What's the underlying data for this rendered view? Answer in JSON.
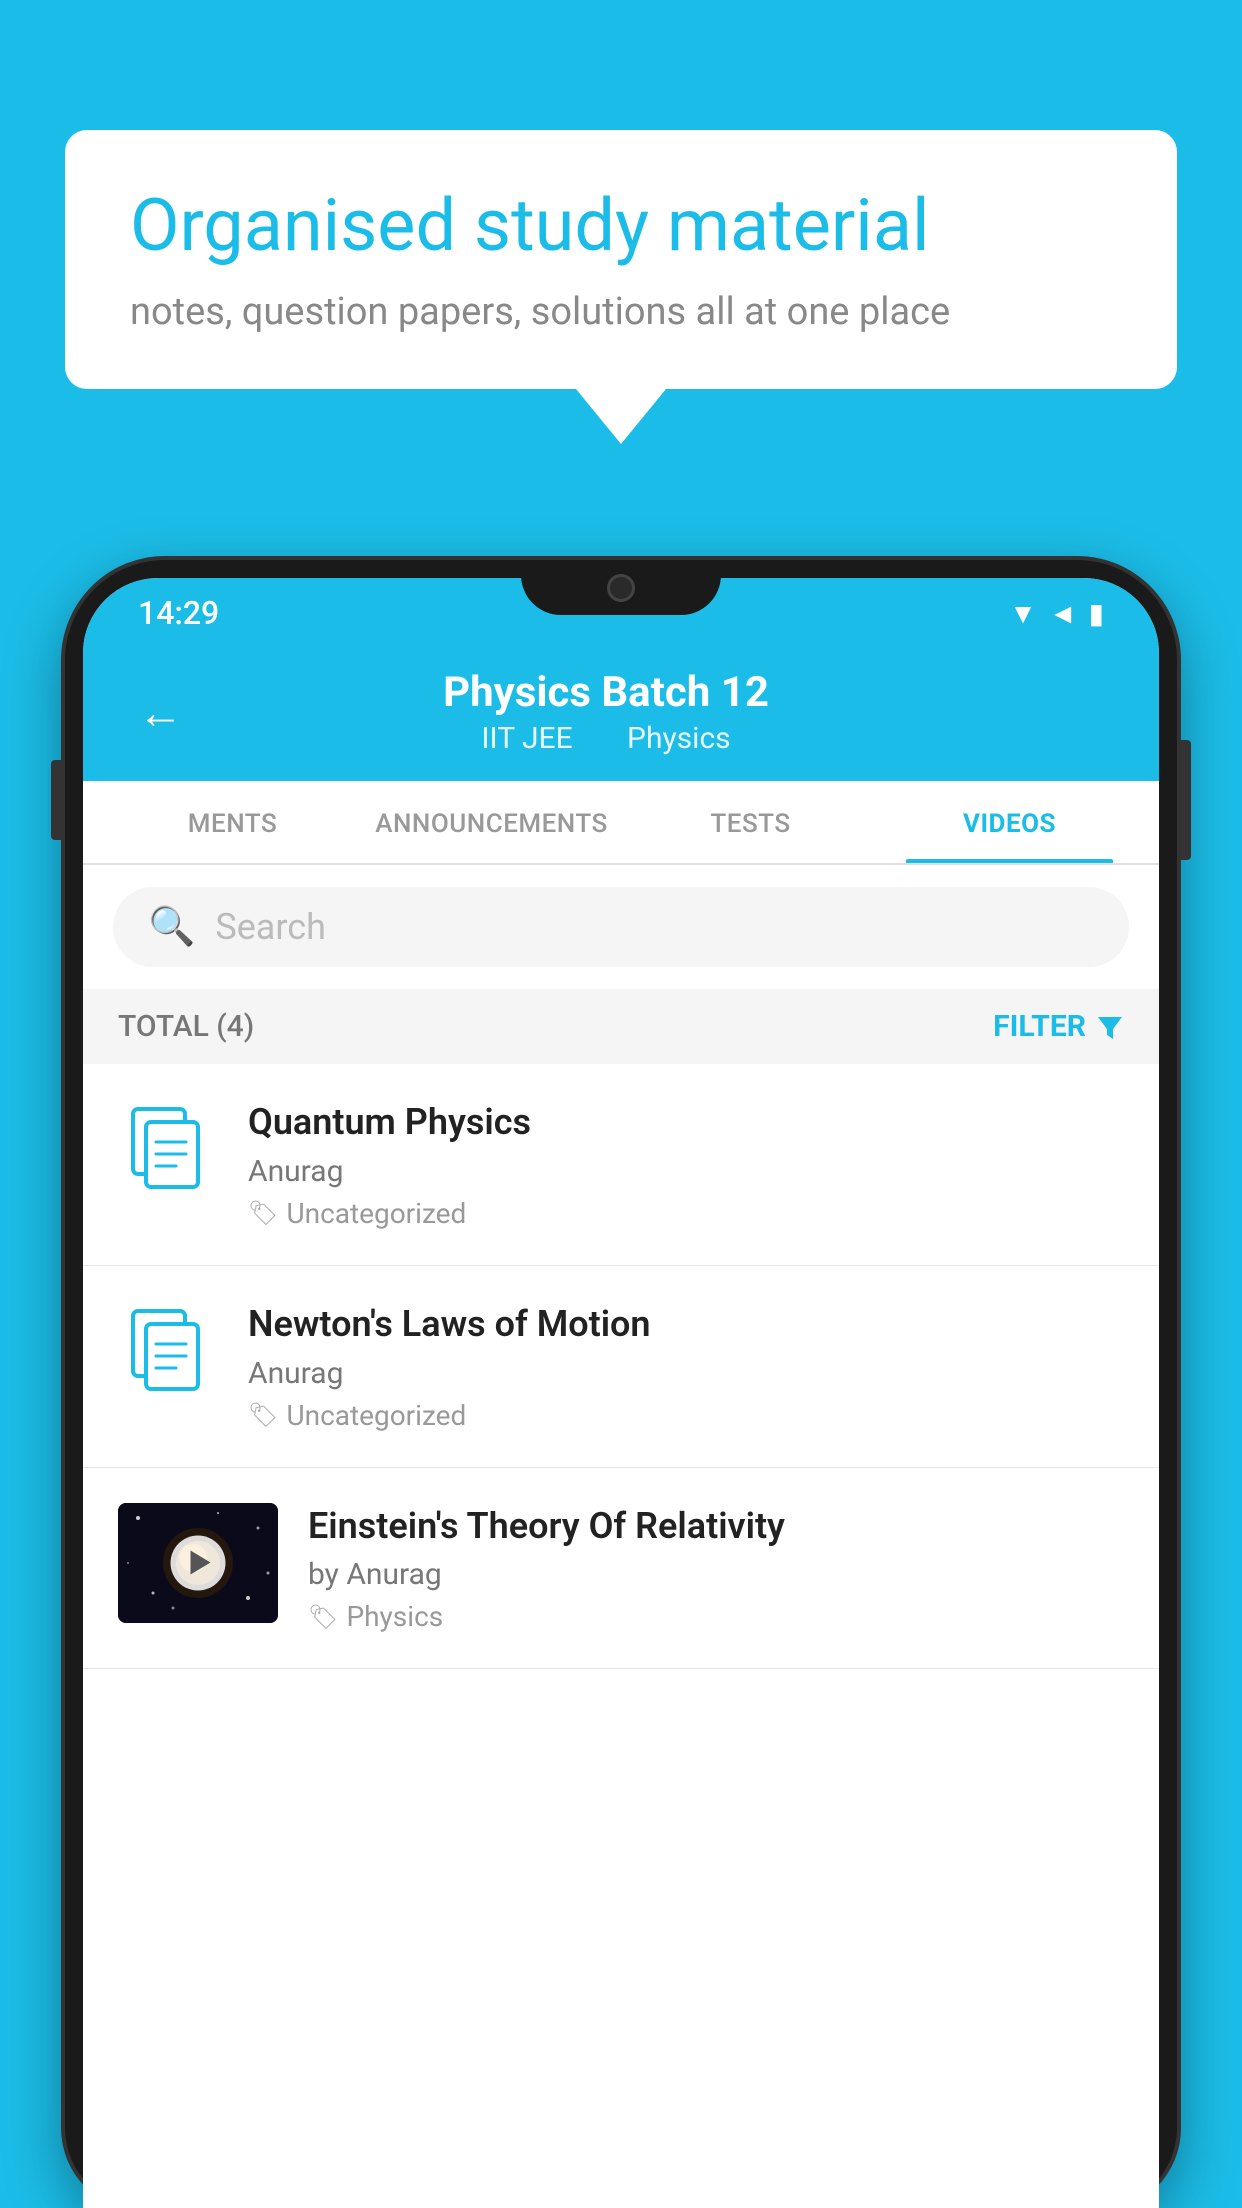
{
  "background_color": "#1BBDE8",
  "speech_bubble": {
    "title": "Organised study material",
    "subtitle": "notes, question papers, solutions all at one place"
  },
  "status_bar": {
    "time": "14:29"
  },
  "app_header": {
    "back_label": "←",
    "title": "Physics Batch 12",
    "subtitle_part1": "IIT JEE",
    "subtitle_part2": "Physics"
  },
  "tabs": [
    {
      "label": "MENTS",
      "active": false
    },
    {
      "label": "ANNOUNCEMENTS",
      "active": false
    },
    {
      "label": "TESTS",
      "active": false
    },
    {
      "label": "VIDEOS",
      "active": true
    }
  ],
  "search": {
    "placeholder": "Search"
  },
  "filter_bar": {
    "total_label": "TOTAL (4)",
    "filter_label": "FILTER"
  },
  "videos": [
    {
      "id": 1,
      "title": "Quantum Physics",
      "author": "Anurag",
      "tag": "Uncategorized",
      "has_thumb": false,
      "thumb_bg": ""
    },
    {
      "id": 2,
      "title": "Newton's Laws of Motion",
      "author": "Anurag",
      "tag": "Uncategorized",
      "has_thumb": false,
      "thumb_bg": ""
    },
    {
      "id": 3,
      "title": "Einstein's Theory Of Relativity",
      "author_prefix": "by ",
      "author": "Anurag",
      "tag": "Physics",
      "has_thumb": true,
      "thumb_bg": "#1a1a2e"
    }
  ]
}
